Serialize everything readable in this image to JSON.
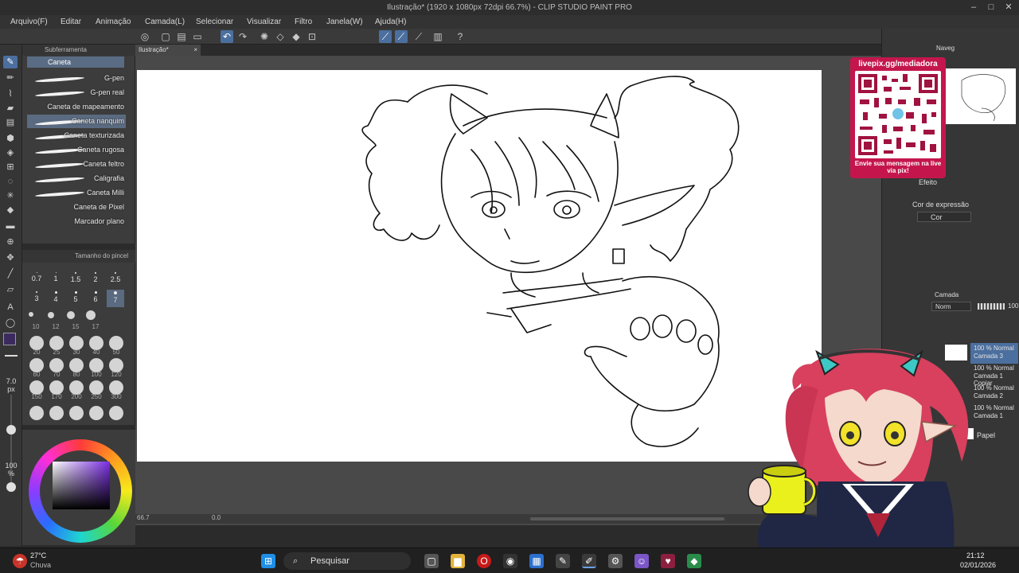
{
  "window": {
    "title": "Ilustração* (1920 x 1080px 72dpi 66.7%) - CLIP STUDIO PAINT PRO"
  },
  "menu": [
    "Arquivo(F)",
    "Editar",
    "Animação",
    "Camada(L)",
    "Selecionar",
    "Visualizar",
    "Filtro",
    "Janela(W)",
    "Ajuda(H)"
  ],
  "subtool": {
    "header": "Subferramenta",
    "group": "Caneta",
    "brushes": [
      "G-pen",
      "G-pen real",
      "Caneta de mapeamento",
      "Caneta nanquim",
      "Caneta texturizada",
      "Caneta rugosa",
      "Caneta feltro",
      "Caligrafia",
      "Caneta Milli",
      "Caneta de Pixel",
      "Marcador plano"
    ],
    "selected_index": 3
  },
  "brush_size": {
    "header": "Tamanho do pincel",
    "small_sizes": [
      "0.7",
      "1",
      "1.5",
      "2",
      "2.5",
      "3",
      "4",
      "5",
      "6",
      "7"
    ],
    "medium_sizes": [
      "10",
      "12",
      "15",
      "17"
    ],
    "large_sizes": [
      "20",
      "25",
      "30",
      "40",
      "50",
      "60",
      "70",
      "80",
      "100",
      "120",
      "150",
      "170",
      "200",
      "250",
      "300"
    ],
    "selected": "7"
  },
  "left_sliders": {
    "size_value": "7.0",
    "size_unit": "px",
    "opacity_value": "100",
    "opacity_unit": "%"
  },
  "canvas": {
    "tab": "Ilustração*",
    "zoom": "66.7",
    "rotation": "0.0"
  },
  "overlay": {
    "qr_title": "livepix.gg/mediadora",
    "qr_caption": "Envie sua mensagem na live via pix!"
  },
  "right": {
    "nav_label": "Naveg",
    "effect_label": "Efeito",
    "expression_label": "Cor de expressão",
    "expression_value": "Cor",
    "layer_panel": "Camada",
    "blend": "Norm",
    "opacity": "100",
    "layers": [
      {
        "pct": "100 %",
        "mode": "Normal",
        "name": "Camada 3"
      },
      {
        "pct": "100 %",
        "mode": "Normal",
        "name": "Camada 1 Copiar"
      },
      {
        "pct": "100 %",
        "mode": "Normal",
        "name": "Camada 2"
      },
      {
        "pct": "100 %",
        "mode": "Normal",
        "name": "Camada 1"
      }
    ],
    "paper_label": "Papel"
  },
  "taskbar": {
    "weather_temp": "27°C",
    "weather_text": "Chuva",
    "search_placeholder": "Pesquisar",
    "time": "21:12",
    "date": "02/01/2026"
  }
}
